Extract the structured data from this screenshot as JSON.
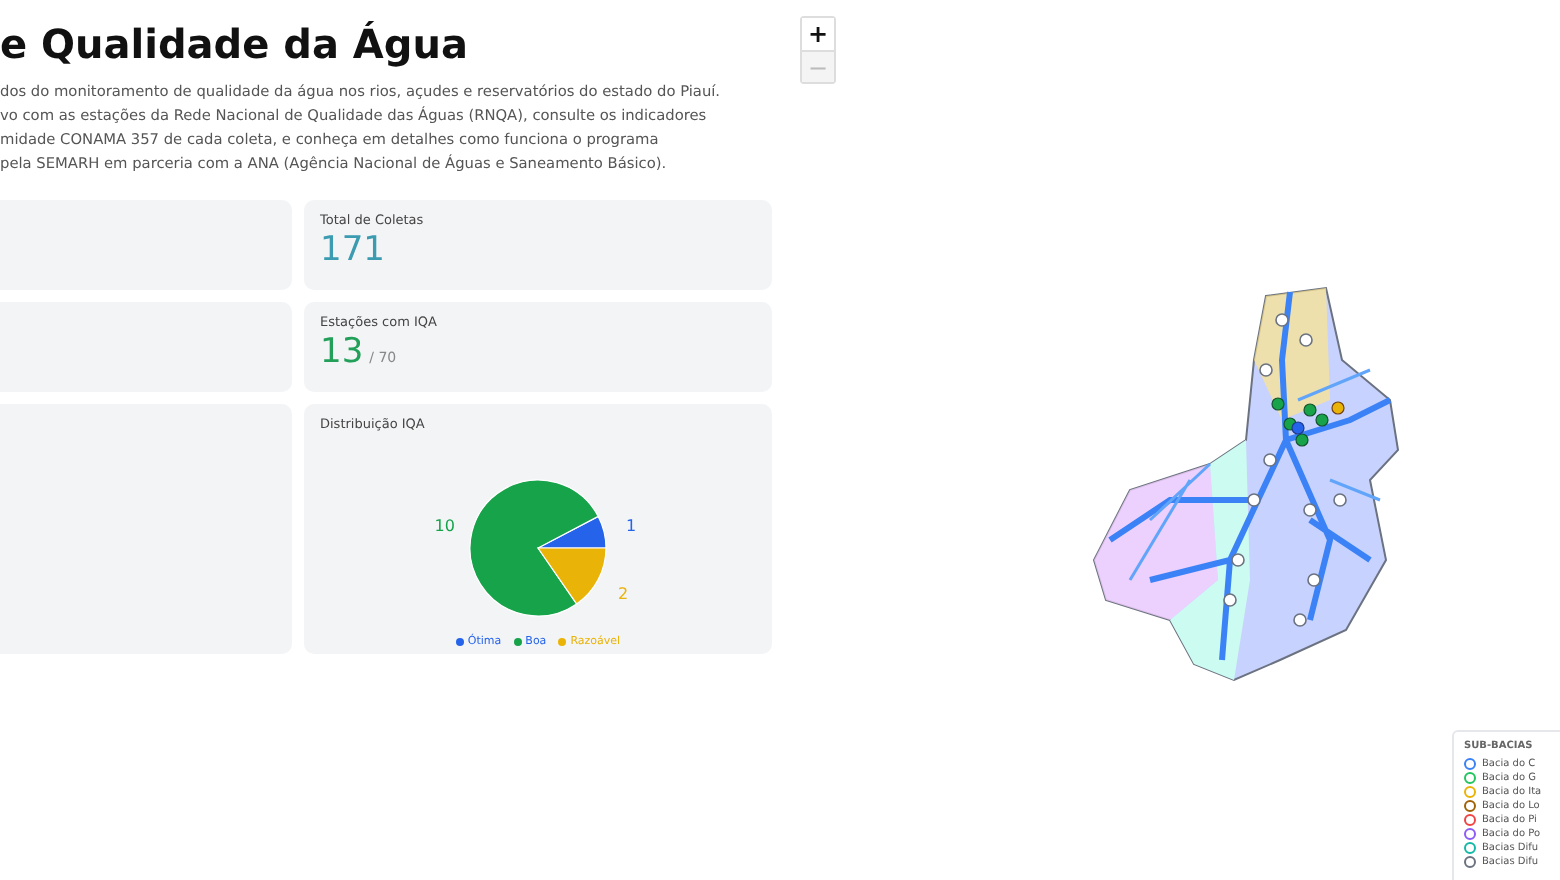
{
  "header": {
    "title": "e Qualidade da Água",
    "description_lines": [
      "dos do monitoramento de qualidade da água nos rios, açudes e reservatórios do estado do Piauí.",
      "vo com as estações da Rede Nacional de Qualidade das Águas (RNQA), consulte os indicadores",
      "midade CONAMA 357 de cada coleta, e conheça em detalhes como funciona o programa",
      "pela SEMARH em parceria com a ANA (Agência Nacional de Águas e Saneamento Básico)."
    ]
  },
  "stats": [
    {
      "label": "Total de Coletas",
      "value": "171",
      "color": "#3b9bb0"
    },
    {
      "label": "Estações com IQA",
      "value": "13",
      "suffix": "/ 70",
      "color": "#22a05a"
    }
  ],
  "iqa_card": {
    "label": "Distribuição IQA",
    "chart_data": {
      "type": "pie",
      "categories": [
        "Ótima",
        "Boa",
        "Razoável"
      ],
      "values": [
        1,
        10,
        2
      ],
      "colors": [
        "#2563eb",
        "#16a34a",
        "#eab308"
      ],
      "data_labels": true,
      "legend": "bottom"
    }
  },
  "map": {
    "zoom_buttons": [
      {
        "label": "+",
        "disabled": false
      },
      {
        "label": "−",
        "disabled": true
      }
    ],
    "legend": {
      "title": "SUB-BACIAS",
      "items": [
        {
          "label": "Bacia do C",
          "color": "#3b82f6"
        },
        {
          "label": "Bacia do G",
          "color": "#22c55e"
        },
        {
          "label": "Bacia do Ita",
          "color": "#eab308"
        },
        {
          "label": "Bacia do Lo",
          "color": "#a16207"
        },
        {
          "label": "Bacia do Pi",
          "color": "#ef4444"
        },
        {
          "label": "Bacia do Po",
          "color": "#8b5cf6"
        },
        {
          "label": "Bacias Difu",
          "color": "#14b8a6"
        },
        {
          "label": "Bacias Difu",
          "color": "#6b7280"
        }
      ]
    }
  }
}
